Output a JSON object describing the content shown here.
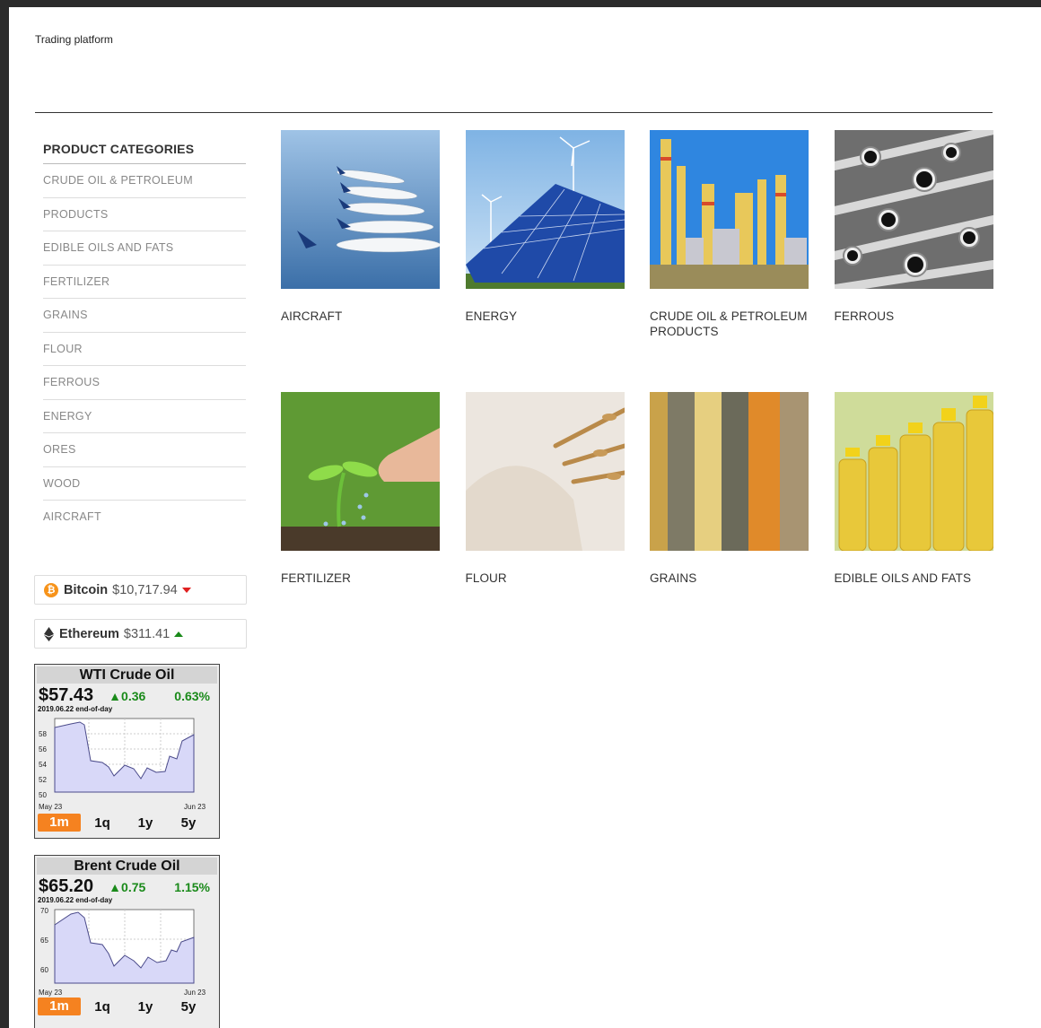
{
  "site": {
    "title": "Trading platform"
  },
  "sidebar": {
    "title": "PRODUCT CATEGORIES",
    "items": [
      "CRUDE OIL & PETROLEUM",
      "PRODUCTS",
      "EDIBLE OILS AND FATS",
      "FERTILIZER",
      "GRAINS",
      "FLOUR",
      "FERROUS",
      "ENERGY",
      "ORES",
      "WOOD",
      "AIRCRAFT"
    ]
  },
  "crypto": {
    "bitcoin": {
      "name": "Bitcoin",
      "price": "$10,717.94",
      "direction": "down",
      "icon": "bitcoin-icon"
    },
    "ethereum": {
      "name": "Ethereum",
      "price": "$311.41",
      "direction": "up",
      "icon": "ethereum-icon"
    }
  },
  "oil_widgets": [
    {
      "title": "WTI Crude Oil",
      "price": "$57.43",
      "change": "▲0.36",
      "pct": "0.63%",
      "date": "2019.06.22 end-of-day",
      "y_ticks": [
        "58",
        "56",
        "54",
        "52",
        "50"
      ],
      "x_start": "May 23",
      "x_end": "Jun 23",
      "ranges": [
        "1m",
        "1q",
        "1y",
        "5y"
      ],
      "active_range": "1m"
    },
    {
      "title": "Brent Crude Oil",
      "price": "$65.20",
      "change": "▲0.75",
      "pct": "1.15%",
      "date": "2019.06.22 end-of-day",
      "y_ticks": [
        "70",
        "65",
        "60"
      ],
      "x_start": "May 23",
      "x_end": "Jun 23",
      "ranges": [
        "1m",
        "1q",
        "1y",
        "5y"
      ],
      "active_range": "1m"
    }
  ],
  "products": [
    {
      "label": "AIRCRAFT",
      "image": "aircraft"
    },
    {
      "label": "ENERGY",
      "image": "energy"
    },
    {
      "label": "CRUDE OIL & PETROLEUM PRODUCTS",
      "image": "refinery"
    },
    {
      "label": "FERROUS",
      "image": "pipes"
    },
    {
      "label": "FERTILIZER",
      "image": "fertilizer"
    },
    {
      "label": "FLOUR",
      "image": "flour"
    },
    {
      "label": "GRAINS",
      "image": "grains"
    },
    {
      "label": "EDIBLE OILS AND FATS",
      "image": "oil-bottles"
    }
  ],
  "colors": {
    "accent": "#f58220",
    "up": "#1a8a1a",
    "down": "#e02020",
    "chart_fill": "#d8d8f8",
    "chart_line": "#4a4a8a"
  }
}
